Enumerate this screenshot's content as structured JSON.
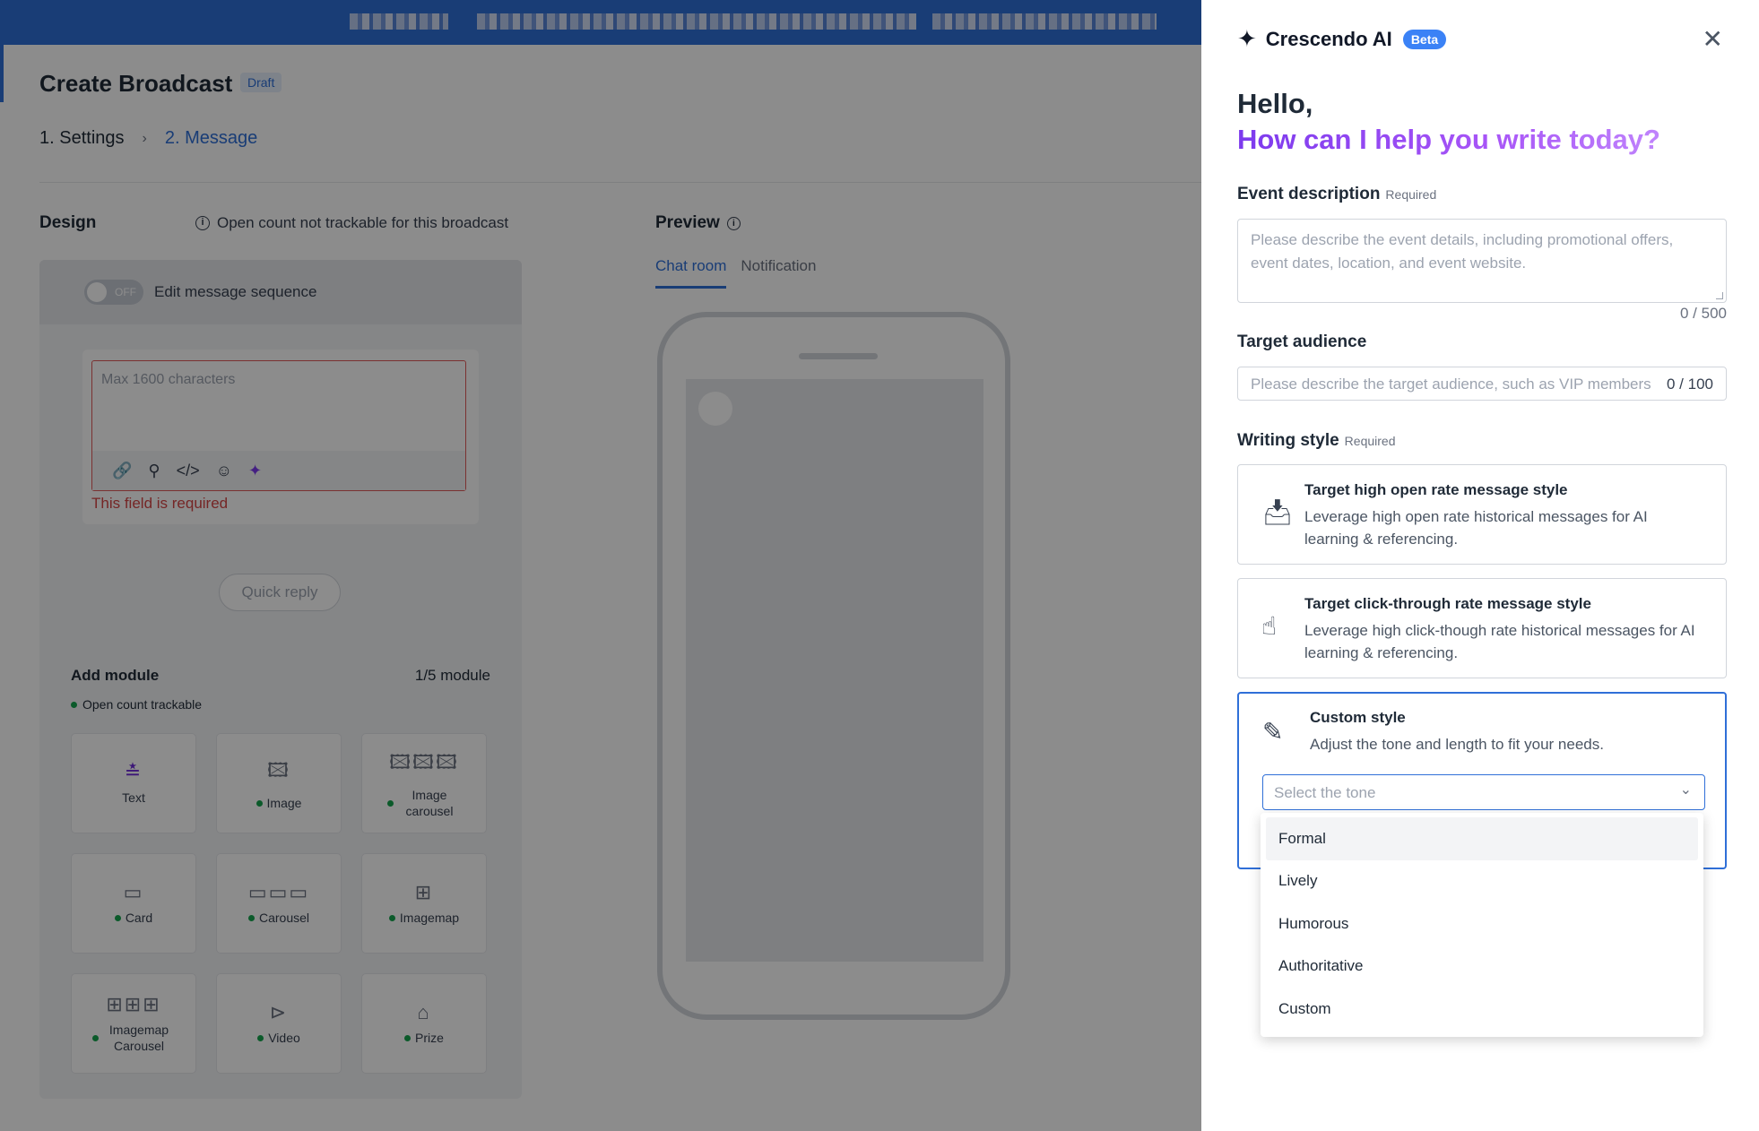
{
  "app": {
    "page_title": "Create Broadcast",
    "draft_badge": "Draft",
    "steps": {
      "settings": "1. Settings",
      "separator": "›",
      "message": "2. Message"
    },
    "design": {
      "title": "Design",
      "open_count_note": "Open count not trackable for this broadcast",
      "toggle_state": "OFF",
      "sequence_label": "Edit message sequence",
      "message_placeholder": "Max 1600 characters",
      "error": "This field is required",
      "quick_reply": "Quick reply",
      "add_module": "Add module",
      "module_count": "1/5 module",
      "trackable_note": "Open count trackable",
      "modules": [
        {
          "label": "Text",
          "icon": "text-icon",
          "glyph": "≛",
          "dot": false
        },
        {
          "label": "Image",
          "icon": "image-icon",
          "glyph": "🖾",
          "dot": true
        },
        {
          "label": "Image carousel",
          "icon": "image-carousel-icon",
          "glyph": "🖾🖾🖾",
          "dot": true
        },
        {
          "label": "Card",
          "icon": "card-icon",
          "glyph": "▭",
          "dot": true
        },
        {
          "label": "Carousel",
          "icon": "carousel-icon",
          "glyph": "▭▭▭",
          "dot": true
        },
        {
          "label": "Imagemap",
          "icon": "imagemap-icon",
          "glyph": "⊞",
          "dot": true
        },
        {
          "label": "Imagemap Carousel",
          "icon": "imagemap-carousel-icon",
          "glyph": "⊞⊞⊞",
          "dot": true
        },
        {
          "label": "Video",
          "icon": "video-icon",
          "glyph": "⊳",
          "dot": true
        },
        {
          "label": "Prize",
          "icon": "prize-icon",
          "glyph": "⌂",
          "dot": true
        }
      ]
    },
    "preview": {
      "title": "Preview",
      "tabs": [
        "Chat room",
        "Notification"
      ]
    }
  },
  "ai": {
    "name": "Crescendo AI",
    "badge": "Beta",
    "greeting": "Hello,",
    "subtitle": "How can I help you write today?",
    "event": {
      "label": "Event description",
      "required": "Required",
      "placeholder": "Please describe the event details, including promotional offers, event dates, location, and event website.",
      "count": "0 / 500"
    },
    "audience": {
      "label": "Target audience",
      "placeholder": "Please describe the target audience, such as VIP members",
      "count": "0 / 100"
    },
    "writing_style": {
      "label": "Writing style",
      "required": "Required",
      "options": [
        {
          "title": "Target high open rate message style",
          "desc": "Leverage high open rate historical messages for AI learning & referencing.",
          "icon": "inbox-icon"
        },
        {
          "title": "Target click-through rate message style",
          "desc": "Leverage high click-though rate historical messages for AI learning & referencing.",
          "icon": "pointer-icon"
        },
        {
          "title": "Custom style",
          "desc": "Adjust the tone and length to fit your needs.",
          "icon": "pencil-icon"
        }
      ]
    },
    "tone": {
      "placeholder": "Select the tone",
      "options": [
        "Formal",
        "Lively",
        "Humorous",
        "Authoritative",
        "Custom"
      ],
      "highlighted": "Formal"
    }
  },
  "colors": {
    "brand": "#2f6fd8",
    "ai_gradient_start": "#7c3aed",
    "error": "#d64545",
    "trackable_dot": "#14a44d"
  }
}
